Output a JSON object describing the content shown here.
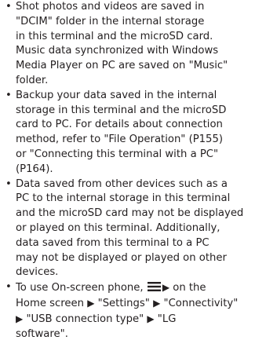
{
  "bullet_symbol": "•",
  "arrow_symbol": "▶",
  "items": [
    {
      "lines": [
        "Shot photos and videos are saved in",
        "\"DCIM\" folder in the internal storage",
        "in this terminal and the microSD card.",
        "Music data synchronized with Windows",
        "Media Player on PC are saved on \"Music\"",
        "folder."
      ]
    },
    {
      "lines": [
        "Backup your data saved in the internal",
        "storage in this terminal and the microSD",
        "card to PC. For details about connection",
        "method, refer to \"File Operation\" (P155)",
        "or \"Connecting this terminal with a PC\"",
        "(P164)."
      ]
    },
    {
      "lines": [
        "Data saved from other devices such as a",
        "PC to the internal storage in this terminal",
        "and the microSD card may not be displayed",
        "or played on this terminal. Additionally,",
        "data saved from this terminal to a PC",
        "may not be displayed or played on other",
        "devices."
      ]
    },
    {
      "line1_before": "To use On-screen phone,",
      "menu_icon": "menu-icon",
      "line1_after": "on the",
      "line2_a": "Home screen",
      "line2_b": "\"Settings\"",
      "line2_c": "\"Connectivity\"",
      "line3_a": "\"USB connection type\"",
      "line3_b": "\"LG",
      "line4": "software\"."
    }
  ]
}
